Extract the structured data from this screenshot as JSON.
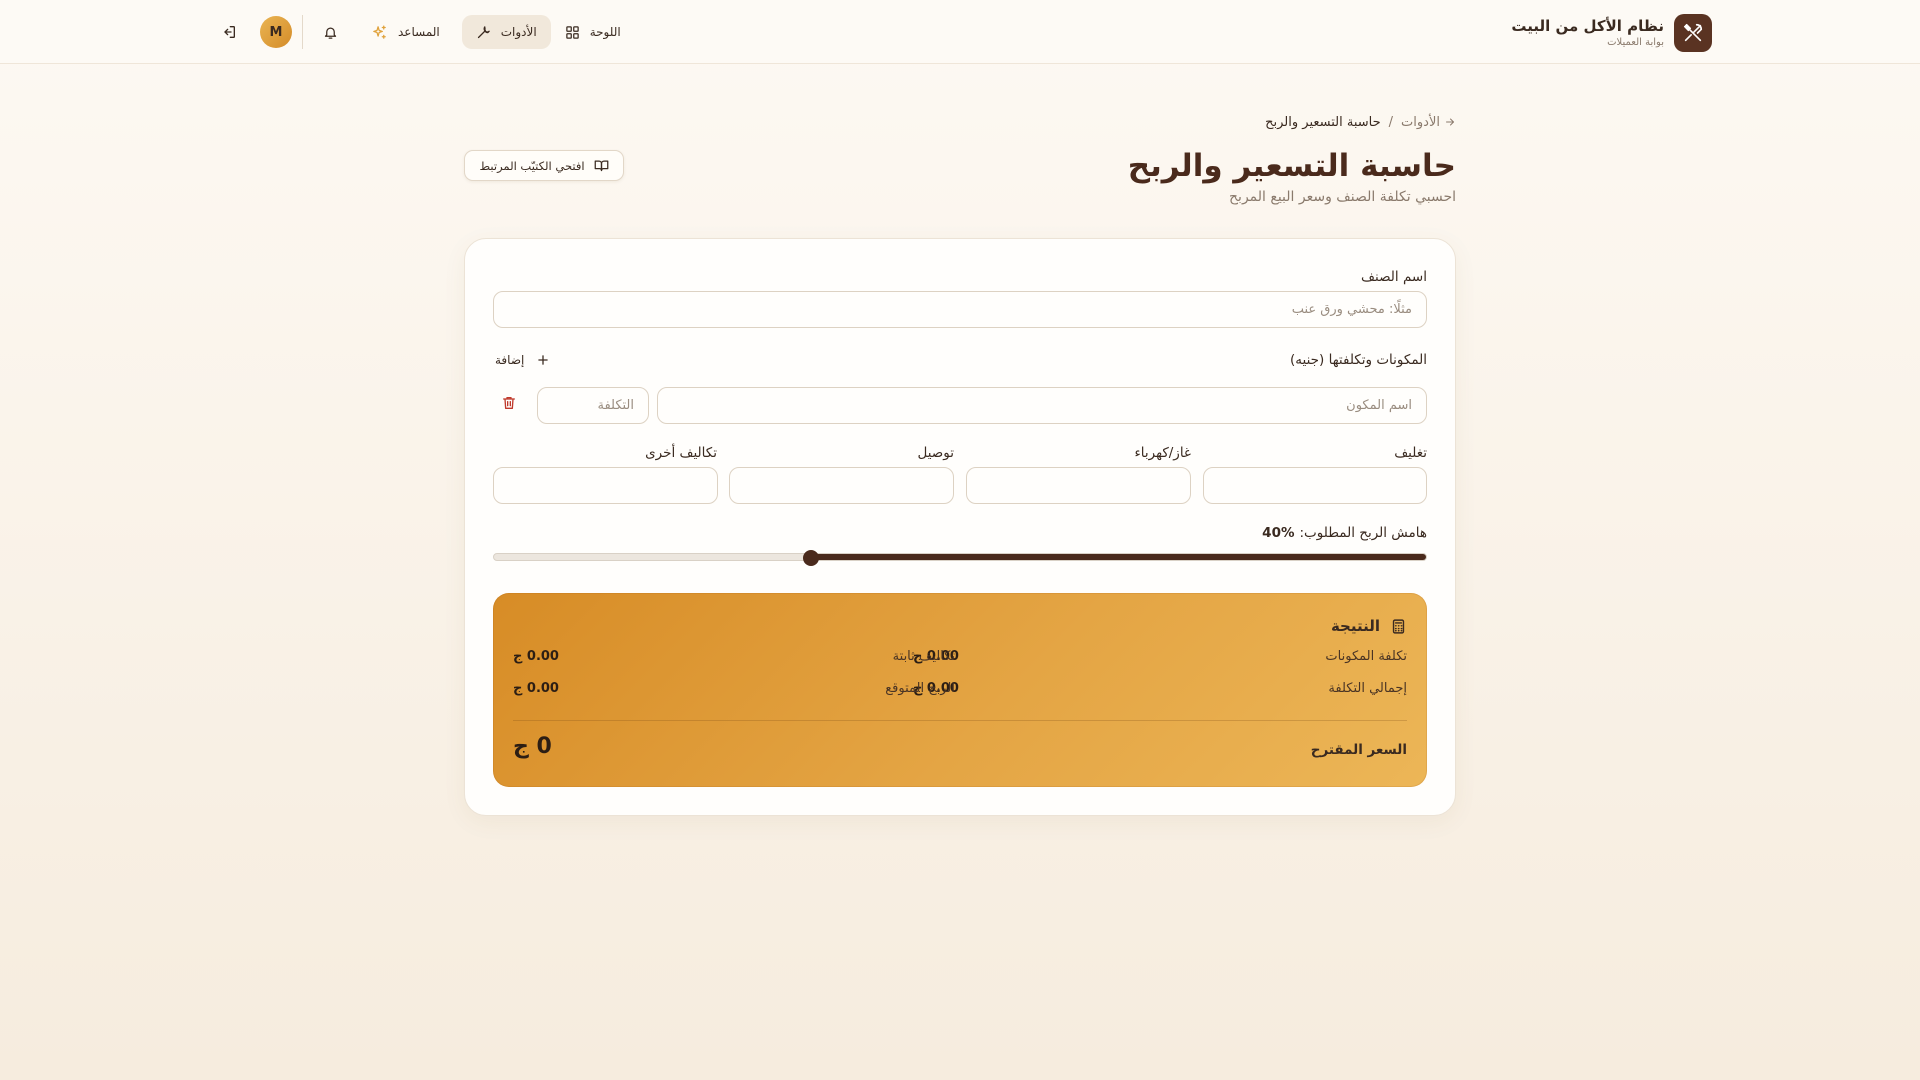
{
  "brand": {
    "title": "نظام الأكل من البيت",
    "subtitle": "بوابة العميلات"
  },
  "nav": {
    "dashboard": "اللوحة",
    "tools": "الأدوات",
    "assistant": "المساعد",
    "avatar_initial": "M"
  },
  "breadcrumb": {
    "parent": "الأدوات",
    "separator": "/",
    "current": "حاسبة التسعير والربح"
  },
  "page": {
    "title": "حاسبة التسعير والربح",
    "subtitle": "احسبي تكلفة الصنف وسعر البيع المربح",
    "notebook_button": "افتحي الكتيّب المرتبط"
  },
  "form": {
    "item_name_label": "اسم الصنف",
    "item_name_placeholder": "مثلًا: محشي ورق عنب",
    "ingredients_label": "المكونات وتكلفتها (جنيه)",
    "add_label": "إضافة",
    "ingredient_name_placeholder": "اسم المكون",
    "ingredient_cost_placeholder": "التكلفة",
    "fixed_costs": [
      {
        "label": "تغليف",
        "value": ""
      },
      {
        "label": "غاز/كهرباء",
        "value": ""
      },
      {
        "label": "توصيل",
        "value": ""
      },
      {
        "label": "تكاليف أخرى",
        "value": ""
      }
    ],
    "margin_label": "هامش الربح المطلوب:",
    "margin_value": "40%",
    "margin_fraction": 0.4
  },
  "result": {
    "title": "النتيجة",
    "ingredients_cost_label": "تكلفة المكونات",
    "ingredients_cost_value": "0.00 ج",
    "fixed_costs_label": "تكاليف ثابتة",
    "fixed_costs_value": "0.00 ج",
    "total_cost_label": "إجمالي التكلفة",
    "total_cost_value": "0.00 ج",
    "expected_profit_label": "الربح المتوقع",
    "expected_profit_value": "0.00 ج",
    "suggested_price_label": "السعر المقترح",
    "suggested_price_value": "0 ج"
  },
  "icons": {
    "brand": "utensils-icon",
    "dashboard": "grid-icon",
    "tools": "wrench-icon",
    "assistant": "sparkles-icon",
    "notifications": "bell-icon",
    "logout": "logout-icon",
    "notebook": "book-icon",
    "add": "plus-icon",
    "delete": "trash-icon",
    "result": "calculator-icon"
  },
  "colors": {
    "brand_dark": "#4a2a1c",
    "accent": "#e4a544",
    "danger": "#c0392b",
    "background": "#fbf5ec"
  }
}
